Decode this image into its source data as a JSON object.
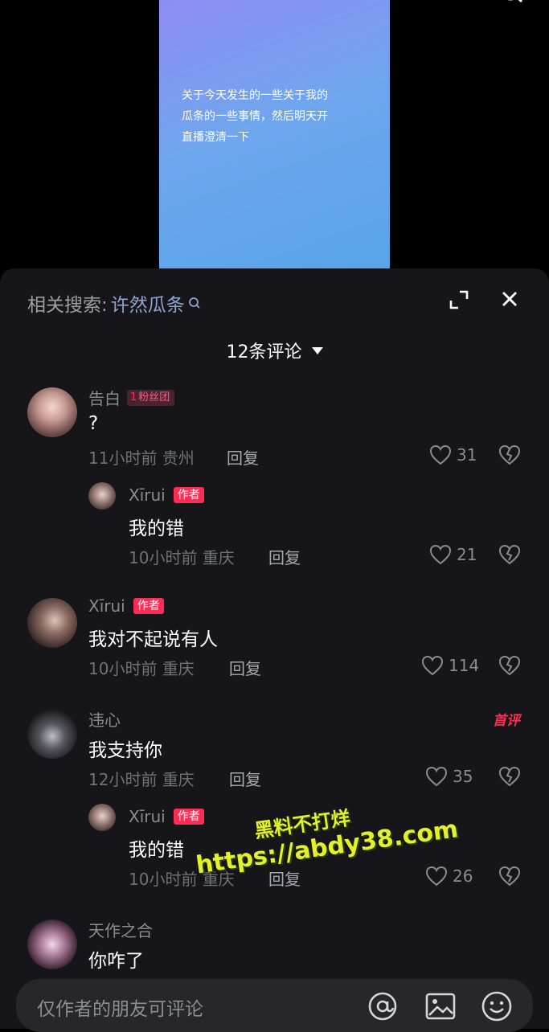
{
  "video": {
    "caption": "关于今天发生的一些关于我的\n瓜条的一些事情，然后明天开\n直播澄清一下"
  },
  "panel": {
    "related_label": "相关搜索:",
    "related_keyword": "许然瓜条",
    "comment_count": "12条评论"
  },
  "comments": [
    {
      "user": "告白",
      "badge": "粉丝团",
      "badge_level": "1",
      "text": "?",
      "time": "11小时前",
      "location": "贵州",
      "reply": "回复",
      "likes": "31",
      "replies": [
        {
          "user": "Xīrui",
          "badge": "作者",
          "text": "我的错",
          "time": "10小时前",
          "location": "重庆",
          "reply": "回复",
          "likes": "21"
        }
      ]
    },
    {
      "user": "Xīrui",
      "badge": "作者",
      "text": "我对不起说有人",
      "time": "10小时前",
      "location": "重庆",
      "reply": "回复",
      "likes": "114"
    },
    {
      "user": "违心",
      "tag": "首评",
      "text": "我支持你",
      "time": "12小时前",
      "location": "重庆",
      "reply": "回复",
      "likes": "35",
      "replies": [
        {
          "user": "Xīrui",
          "badge": "作者",
          "text": "我的错",
          "time": "10小时前",
          "location": "重庆",
          "reply": "回复",
          "likes": "26"
        }
      ]
    },
    {
      "user": "天作之合",
      "text": "你咋了"
    }
  ],
  "input": {
    "placeholder": "仅作者的朋友可评论",
    "icons": [
      "at-icon",
      "image-icon",
      "emoji-icon"
    ]
  },
  "watermark": {
    "line1": "黑料不打烊",
    "line2": "https://abdy38.com"
  },
  "colors": {
    "panel_bg": "#16161a",
    "accent": "#fe2c55",
    "keyword": "#8ea5d2"
  }
}
